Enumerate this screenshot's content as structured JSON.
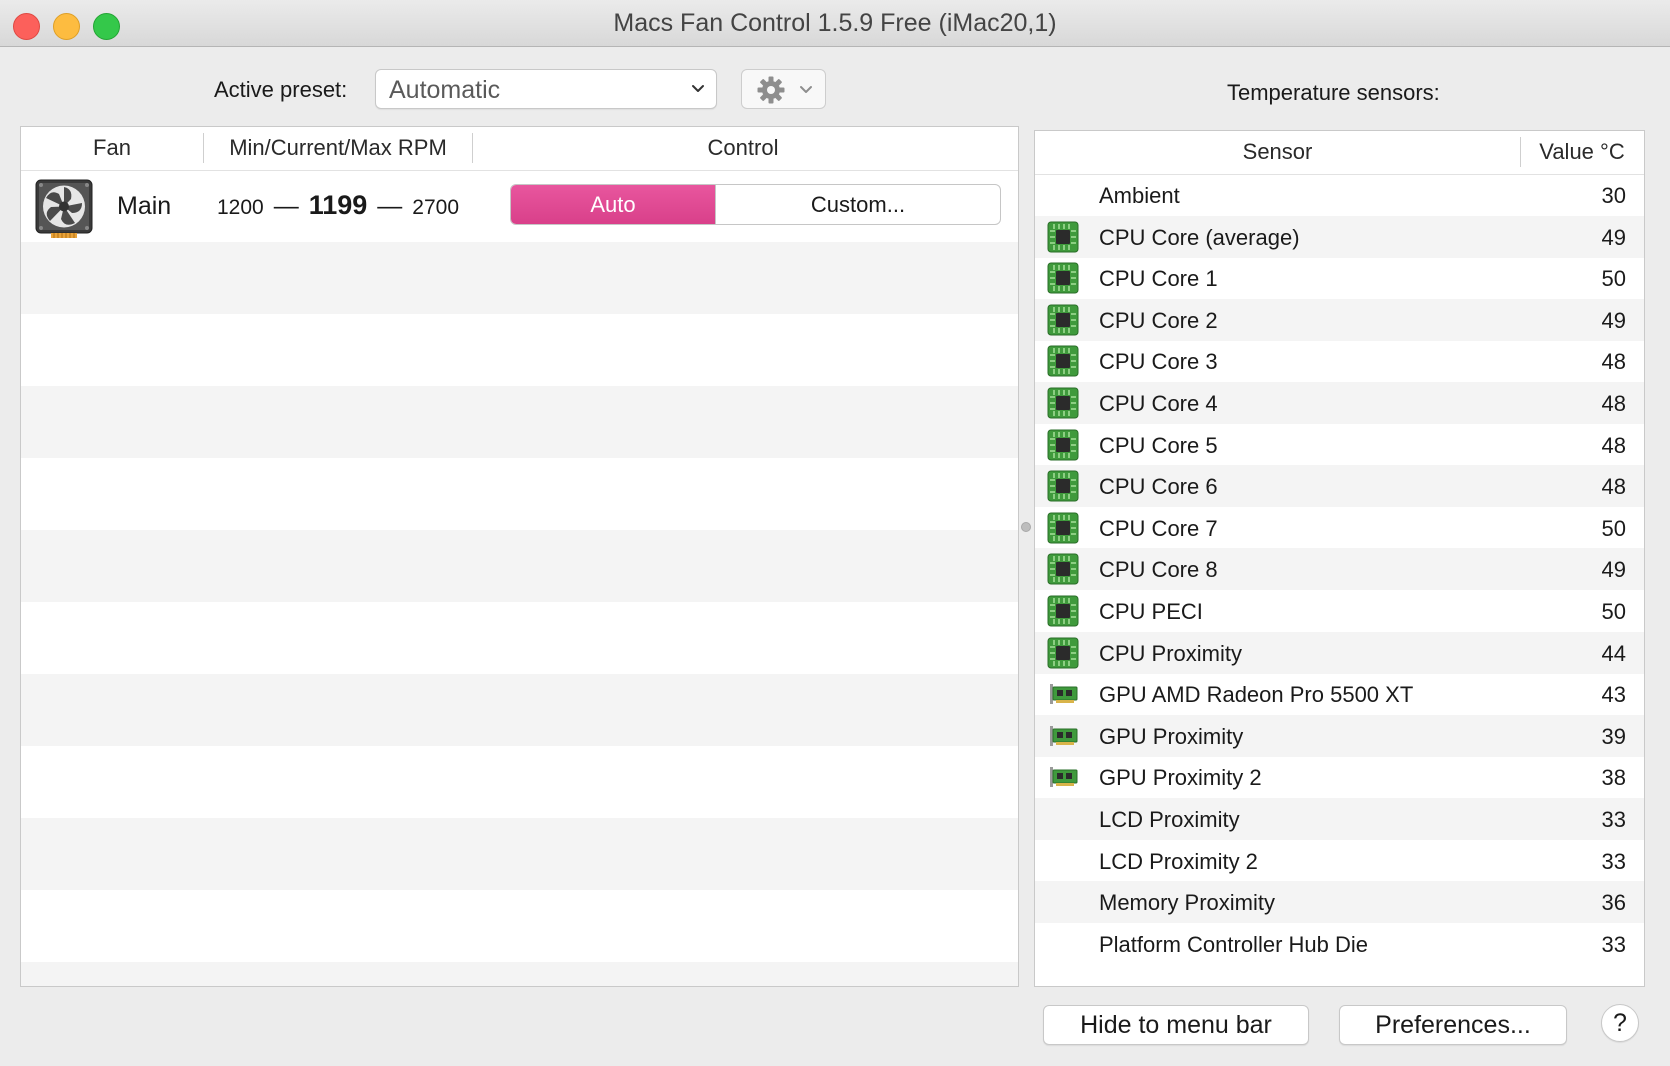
{
  "window": {
    "title": "Macs Fan Control 1.5.9 Free (iMac20,1)"
  },
  "preset": {
    "label": "Active preset:",
    "value": "Automatic"
  },
  "temperature_label": "Temperature sensors:",
  "fan_table": {
    "columns": [
      "Fan",
      "Min/Current/Max RPM",
      "Control"
    ],
    "rows": [
      {
        "name": "Main",
        "min_rpm": "1200",
        "current_rpm": "1199",
        "max_rpm": "2700",
        "control_auto": "Auto",
        "control_custom": "Custom...",
        "selected": "Auto"
      }
    ]
  },
  "sensor_table": {
    "columns": [
      "Sensor",
      "Value °C"
    ],
    "rows": [
      {
        "name": "Ambient",
        "value": "30",
        "icon": "none"
      },
      {
        "name": "CPU Core (average)",
        "value": "49",
        "icon": "cpu-chip-icon"
      },
      {
        "name": "CPU Core 1",
        "value": "50",
        "icon": "cpu-chip-icon"
      },
      {
        "name": "CPU Core 2",
        "value": "49",
        "icon": "cpu-chip-icon"
      },
      {
        "name": "CPU Core 3",
        "value": "48",
        "icon": "cpu-chip-icon"
      },
      {
        "name": "CPU Core 4",
        "value": "48",
        "icon": "cpu-chip-icon"
      },
      {
        "name": "CPU Core 5",
        "value": "48",
        "icon": "cpu-chip-icon"
      },
      {
        "name": "CPU Core 6",
        "value": "48",
        "icon": "cpu-chip-icon"
      },
      {
        "name": "CPU Core 7",
        "value": "50",
        "icon": "cpu-chip-icon"
      },
      {
        "name": "CPU Core 8",
        "value": "49",
        "icon": "cpu-chip-icon"
      },
      {
        "name": "CPU PECI",
        "value": "50",
        "icon": "cpu-chip-icon"
      },
      {
        "name": "CPU Proximity",
        "value": "44",
        "icon": "cpu-chip-icon"
      },
      {
        "name": "GPU AMD Radeon Pro 5500 XT",
        "value": "43",
        "icon": "gpu-card-icon"
      },
      {
        "name": "GPU Proximity",
        "value": "39",
        "icon": "gpu-card-icon"
      },
      {
        "name": "GPU Proximity 2",
        "value": "38",
        "icon": "gpu-card-icon"
      },
      {
        "name": "LCD Proximity",
        "value": "33",
        "icon": "none"
      },
      {
        "name": "LCD Proximity 2",
        "value": "33",
        "icon": "none"
      },
      {
        "name": "Memory Proximity",
        "value": "36",
        "icon": "none"
      },
      {
        "name": "Platform Controller Hub Die",
        "value": "33",
        "icon": "none"
      }
    ]
  },
  "buttons": {
    "hide": "Hide to menu bar",
    "preferences": "Preferences...",
    "help": "?"
  },
  "colors": {
    "accent": "#e0478f",
    "chip_green": "#3f9a3c"
  }
}
